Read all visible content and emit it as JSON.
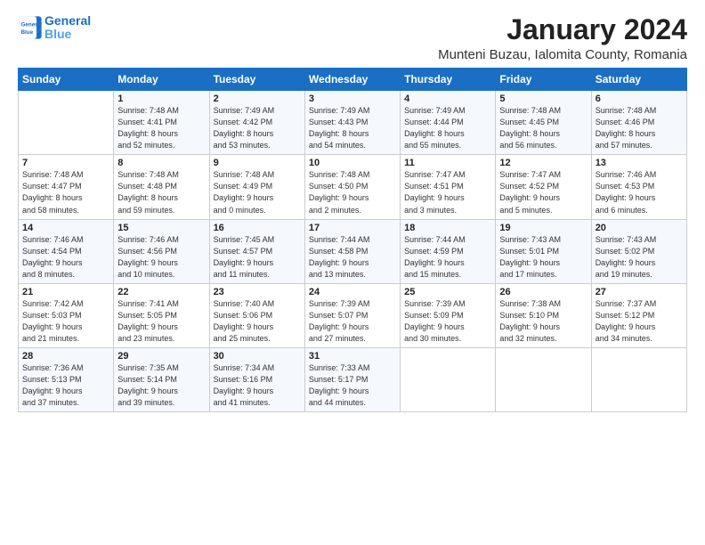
{
  "logo": {
    "line1": "General",
    "line2": "Blue"
  },
  "title": "January 2024",
  "location": "Munteni Buzau, Ialomita County, Romania",
  "headers": [
    "Sunday",
    "Monday",
    "Tuesday",
    "Wednesday",
    "Thursday",
    "Friday",
    "Saturday"
  ],
  "weeks": [
    [
      {
        "day": "",
        "sunrise": "",
        "sunset": "",
        "daylight": ""
      },
      {
        "day": "1",
        "sunrise": "Sunrise: 7:48 AM",
        "sunset": "Sunset: 4:41 PM",
        "daylight": "Daylight: 8 hours and 52 minutes."
      },
      {
        "day": "2",
        "sunrise": "Sunrise: 7:49 AM",
        "sunset": "Sunset: 4:42 PM",
        "daylight": "Daylight: 8 hours and 53 minutes."
      },
      {
        "day": "3",
        "sunrise": "Sunrise: 7:49 AM",
        "sunset": "Sunset: 4:43 PM",
        "daylight": "Daylight: 8 hours and 54 minutes."
      },
      {
        "day": "4",
        "sunrise": "Sunrise: 7:49 AM",
        "sunset": "Sunset: 4:44 PM",
        "daylight": "Daylight: 8 hours and 55 minutes."
      },
      {
        "day": "5",
        "sunrise": "Sunrise: 7:48 AM",
        "sunset": "Sunset: 4:45 PM",
        "daylight": "Daylight: 8 hours and 56 minutes."
      },
      {
        "day": "6",
        "sunrise": "Sunrise: 7:48 AM",
        "sunset": "Sunset: 4:46 PM",
        "daylight": "Daylight: 8 hours and 57 minutes."
      }
    ],
    [
      {
        "day": "7",
        "sunrise": "Sunrise: 7:48 AM",
        "sunset": "Sunset: 4:47 PM",
        "daylight": "Daylight: 8 hours and 58 minutes."
      },
      {
        "day": "8",
        "sunrise": "Sunrise: 7:48 AM",
        "sunset": "Sunset: 4:48 PM",
        "daylight": "Daylight: 8 hours and 59 minutes."
      },
      {
        "day": "9",
        "sunrise": "Sunrise: 7:48 AM",
        "sunset": "Sunset: 4:49 PM",
        "daylight": "Daylight: 9 hours and 0 minutes."
      },
      {
        "day": "10",
        "sunrise": "Sunrise: 7:48 AM",
        "sunset": "Sunset: 4:50 PM",
        "daylight": "Daylight: 9 hours and 2 minutes."
      },
      {
        "day": "11",
        "sunrise": "Sunrise: 7:47 AM",
        "sunset": "Sunset: 4:51 PM",
        "daylight": "Daylight: 9 hours and 3 minutes."
      },
      {
        "day": "12",
        "sunrise": "Sunrise: 7:47 AM",
        "sunset": "Sunset: 4:52 PM",
        "daylight": "Daylight: 9 hours and 5 minutes."
      },
      {
        "day": "13",
        "sunrise": "Sunrise: 7:46 AM",
        "sunset": "Sunset: 4:53 PM",
        "daylight": "Daylight: 9 hours and 6 minutes."
      }
    ],
    [
      {
        "day": "14",
        "sunrise": "Sunrise: 7:46 AM",
        "sunset": "Sunset: 4:54 PM",
        "daylight": "Daylight: 9 hours and 8 minutes."
      },
      {
        "day": "15",
        "sunrise": "Sunrise: 7:46 AM",
        "sunset": "Sunset: 4:56 PM",
        "daylight": "Daylight: 9 hours and 10 minutes."
      },
      {
        "day": "16",
        "sunrise": "Sunrise: 7:45 AM",
        "sunset": "Sunset: 4:57 PM",
        "daylight": "Daylight: 9 hours and 11 minutes."
      },
      {
        "day": "17",
        "sunrise": "Sunrise: 7:44 AM",
        "sunset": "Sunset: 4:58 PM",
        "daylight": "Daylight: 9 hours and 13 minutes."
      },
      {
        "day": "18",
        "sunrise": "Sunrise: 7:44 AM",
        "sunset": "Sunset: 4:59 PM",
        "daylight": "Daylight: 9 hours and 15 minutes."
      },
      {
        "day": "19",
        "sunrise": "Sunrise: 7:43 AM",
        "sunset": "Sunset: 5:01 PM",
        "daylight": "Daylight: 9 hours and 17 minutes."
      },
      {
        "day": "20",
        "sunrise": "Sunrise: 7:43 AM",
        "sunset": "Sunset: 5:02 PM",
        "daylight": "Daylight: 9 hours and 19 minutes."
      }
    ],
    [
      {
        "day": "21",
        "sunrise": "Sunrise: 7:42 AM",
        "sunset": "Sunset: 5:03 PM",
        "daylight": "Daylight: 9 hours and 21 minutes."
      },
      {
        "day": "22",
        "sunrise": "Sunrise: 7:41 AM",
        "sunset": "Sunset: 5:05 PM",
        "daylight": "Daylight: 9 hours and 23 minutes."
      },
      {
        "day": "23",
        "sunrise": "Sunrise: 7:40 AM",
        "sunset": "Sunset: 5:06 PM",
        "daylight": "Daylight: 9 hours and 25 minutes."
      },
      {
        "day": "24",
        "sunrise": "Sunrise: 7:39 AM",
        "sunset": "Sunset: 5:07 PM",
        "daylight": "Daylight: 9 hours and 27 minutes."
      },
      {
        "day": "25",
        "sunrise": "Sunrise: 7:39 AM",
        "sunset": "Sunset: 5:09 PM",
        "daylight": "Daylight: 9 hours and 30 minutes."
      },
      {
        "day": "26",
        "sunrise": "Sunrise: 7:38 AM",
        "sunset": "Sunset: 5:10 PM",
        "daylight": "Daylight: 9 hours and 32 minutes."
      },
      {
        "day": "27",
        "sunrise": "Sunrise: 7:37 AM",
        "sunset": "Sunset: 5:12 PM",
        "daylight": "Daylight: 9 hours and 34 minutes."
      }
    ],
    [
      {
        "day": "28",
        "sunrise": "Sunrise: 7:36 AM",
        "sunset": "Sunset: 5:13 PM",
        "daylight": "Daylight: 9 hours and 37 minutes."
      },
      {
        "day": "29",
        "sunrise": "Sunrise: 7:35 AM",
        "sunset": "Sunset: 5:14 PM",
        "daylight": "Daylight: 9 hours and 39 minutes."
      },
      {
        "day": "30",
        "sunrise": "Sunrise: 7:34 AM",
        "sunset": "Sunset: 5:16 PM",
        "daylight": "Daylight: 9 hours and 41 minutes."
      },
      {
        "day": "31",
        "sunrise": "Sunrise: 7:33 AM",
        "sunset": "Sunset: 5:17 PM",
        "daylight": "Daylight: 9 hours and 44 minutes."
      },
      {
        "day": "",
        "sunrise": "",
        "sunset": "",
        "daylight": ""
      },
      {
        "day": "",
        "sunrise": "",
        "sunset": "",
        "daylight": ""
      },
      {
        "day": "",
        "sunrise": "",
        "sunset": "",
        "daylight": ""
      }
    ]
  ]
}
